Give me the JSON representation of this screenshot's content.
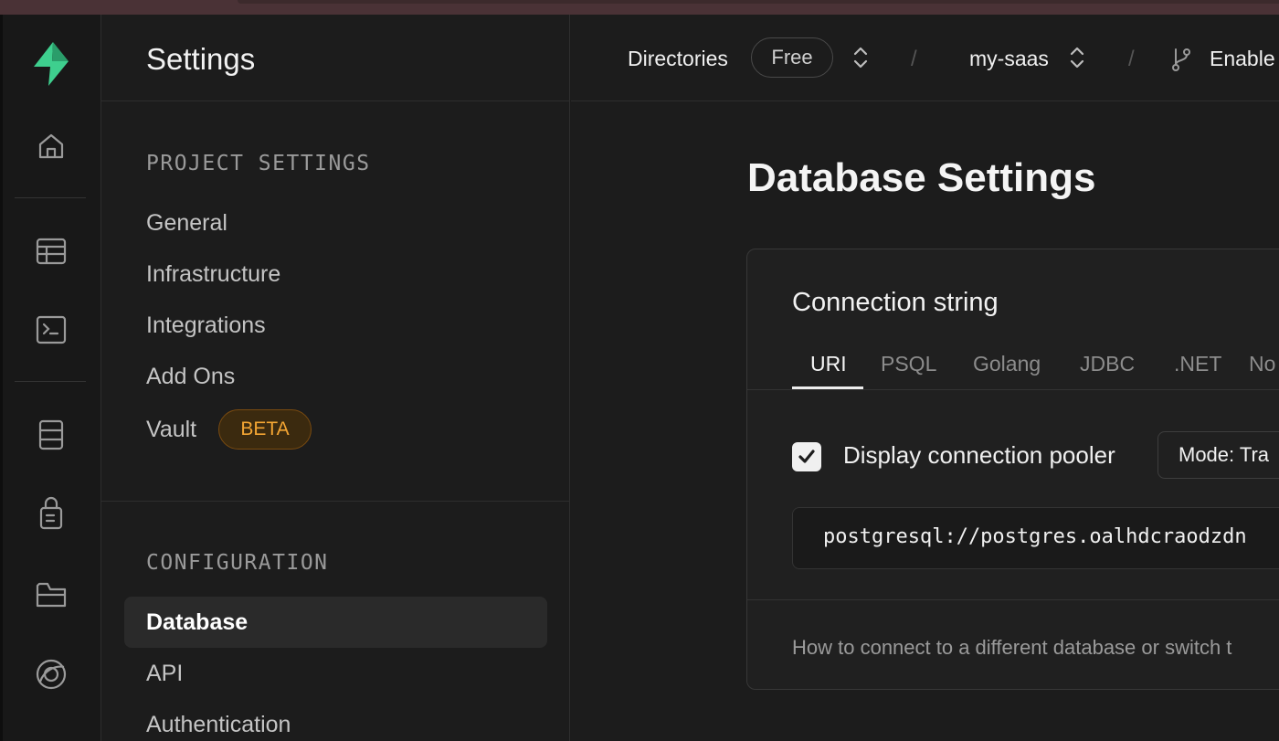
{
  "colors": {
    "brand": "#3ecf8e",
    "beta_text": "#f3a533",
    "beta_bg": "#3b2a0f",
    "background": "#1c1c1c"
  },
  "rail": {
    "items": [
      {
        "icon": "supabase-logo-icon"
      },
      {
        "icon": "home-icon"
      },
      {
        "icon": "table-editor-icon"
      },
      {
        "icon": "sql-editor-icon"
      },
      {
        "icon": "database-icon"
      },
      {
        "icon": "auth-lock-icon"
      },
      {
        "icon": "storage-folder-icon"
      },
      {
        "icon": "realtime-icon"
      }
    ]
  },
  "sidebar": {
    "title": "Settings",
    "project_settings_label": "PROJECT SETTINGS",
    "project_items": [
      "General",
      "Infrastructure",
      "Integrations",
      "Add Ons",
      "Vault"
    ],
    "beta_badge": "BETA",
    "configuration_label": "CONFIGURATION",
    "configuration_items": [
      "Database",
      "API",
      "Authentication"
    ],
    "active_item": "Database"
  },
  "topbar": {
    "org": "Directories",
    "plan": "Free",
    "project": "my-saas",
    "branch_action": "Enable"
  },
  "main": {
    "title": "Database Settings",
    "card": {
      "title": "Connection string",
      "tabs": [
        "URI",
        "PSQL",
        "Golang",
        "JDBC",
        ".NET",
        "No"
      ],
      "active_tab": "URI",
      "pooler_label": "Display connection pooler",
      "pooler_checked": true,
      "mode_value": "Mode: Tra",
      "uri": "postgresql://postgres.oalhdcraodzdn",
      "footer": "How to connect to a different database or switch t"
    }
  }
}
